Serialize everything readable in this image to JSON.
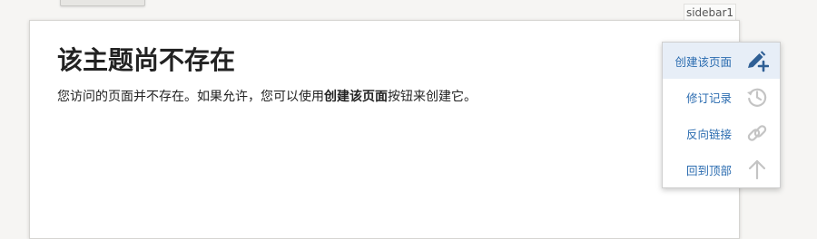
{
  "sidebar_tag": "sidebar1",
  "main": {
    "title": "该主题尚不存在",
    "message_before": "您访问的页面并不存在。如果允许，您可以使用",
    "message_bold": "创建该页面",
    "message_after": "按钮来创建它。"
  },
  "page_tools": [
    {
      "label": "创建该页面",
      "icon": "edit-plus-icon",
      "active": true
    },
    {
      "label": "修订记录",
      "icon": "history-icon",
      "active": false
    },
    {
      "label": "反向链接",
      "icon": "link-icon",
      "active": false
    },
    {
      "label": "回到顶部",
      "icon": "arrow-up-icon",
      "active": false
    }
  ],
  "colors": {
    "link": "#2b6cb0",
    "active_icon": "#2f5f95",
    "inactive_icon": "#c4c4c4",
    "active_bg": "#e7eef7"
  }
}
